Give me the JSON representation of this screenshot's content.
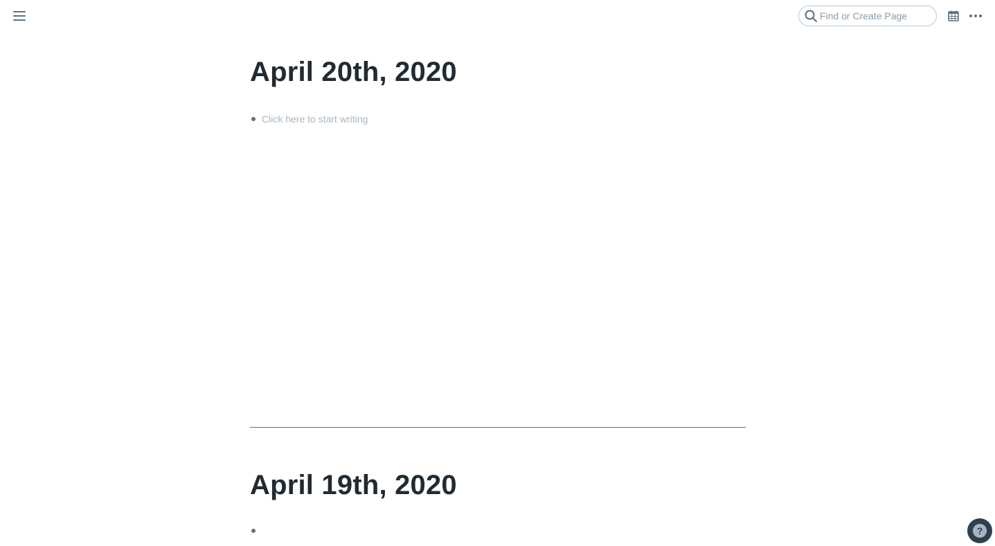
{
  "topbar": {
    "menu_icon": "hamburger-menu-icon",
    "search": {
      "placeholder": "Find or Create Page",
      "value": "",
      "icon": "search-icon"
    },
    "calendar_icon": "calendar-icon",
    "more_icon": "more-horizontal-icon"
  },
  "pages": [
    {
      "title": "April 20th, 2020",
      "blocks": [
        {
          "text": "Click here to start writing",
          "is_placeholder": true
        }
      ]
    },
    {
      "title": "April 19th, 2020",
      "blocks": [
        {
          "text": "",
          "is_placeholder": false
        }
      ]
    }
  ],
  "help": {
    "label": "?",
    "icon": "help-icon"
  },
  "colors": {
    "text": "#202b33",
    "muted": "#a7b6c2",
    "bullet": "#5c7080",
    "divider": "#5c7080",
    "help_bg": "#30404d"
  }
}
